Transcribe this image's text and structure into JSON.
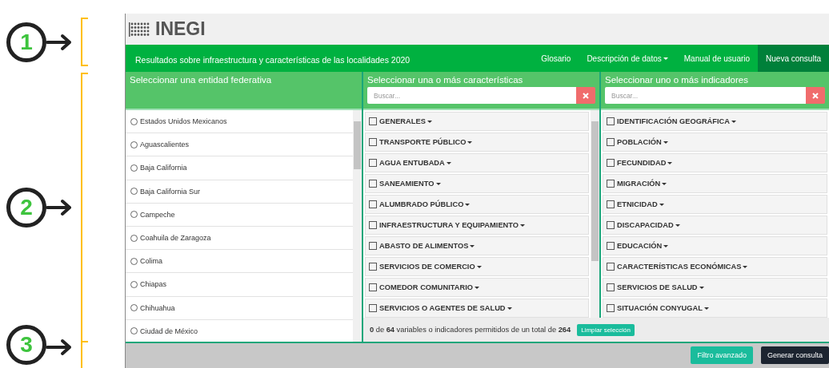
{
  "annotations": [
    {
      "number": "1"
    },
    {
      "number": "2"
    },
    {
      "number": "3"
    }
  ],
  "header": {
    "logo": "INEGI",
    "title": "Resultados sobre infraestructura y características de las localidades 2020",
    "nav": [
      {
        "label": "Glosario",
        "has_menu": false,
        "selected": false
      },
      {
        "label": "Descripción de datos",
        "has_menu": true,
        "selected": false
      },
      {
        "label": "Manual de usuario",
        "has_menu": false,
        "selected": false
      },
      {
        "label": "Nueva consulta",
        "has_menu": false,
        "selected": true
      }
    ]
  },
  "entities": {
    "title": "Seleccionar una entidad federativa",
    "items": [
      {
        "label": "Estados Unidos Mexicanos",
        "selected": false
      },
      {
        "label": "Aguascalientes",
        "selected": false
      },
      {
        "label": "Baja California",
        "selected": false
      },
      {
        "label": "Baja California Sur",
        "selected": false
      },
      {
        "label": "Campeche",
        "selected": false
      },
      {
        "label": "Coahuila de Zaragoza",
        "selected": false
      },
      {
        "label": "Colima",
        "selected": false
      },
      {
        "label": "Chiapas",
        "selected": false
      },
      {
        "label": "Chihuahua",
        "selected": false
      },
      {
        "label": "Ciudad de México",
        "selected": false
      }
    ]
  },
  "characteristics": {
    "title": "Seleccionar una o más características",
    "search": {
      "placeholder": "Buscar..."
    },
    "items": [
      {
        "label": "GENERALES",
        "checked": false
      },
      {
        "label": "TRANSPORTE PÚBLICO",
        "checked": false
      },
      {
        "label": "AGUA ENTUBADA",
        "checked": false
      },
      {
        "label": "SANEAMIENTO",
        "checked": false
      },
      {
        "label": "ALUMBRADO PÚBLICO",
        "checked": false
      },
      {
        "label": "INFRAESTRUCTURA Y EQUIPAMIENTO",
        "checked": false
      },
      {
        "label": "ABASTO DE ALIMENTOS",
        "checked": false
      },
      {
        "label": "SERVICIOS DE COMERCIO",
        "checked": false
      },
      {
        "label": "COMEDOR COMUNITARIO",
        "checked": false
      },
      {
        "label": "SERVICIOS O AGENTES DE SALUD",
        "checked": false
      }
    ]
  },
  "indicators": {
    "title": "Seleccionar uno o más indicadores",
    "search": {
      "placeholder": "Buscar..."
    },
    "items": [
      {
        "label": "IDENTIFICACIÓN GEOGRÁFICA",
        "checked": false
      },
      {
        "label": "POBLACIÓN",
        "checked": false
      },
      {
        "label": "FECUNDIDAD",
        "checked": false
      },
      {
        "label": "MIGRACIÓN",
        "checked": false
      },
      {
        "label": "ETNICIDAD",
        "checked": false
      },
      {
        "label": "DISCAPACIDAD",
        "checked": false
      },
      {
        "label": "EDUCACIÓN",
        "checked": false
      },
      {
        "label": "CARACTERÍSTICAS ECONÓMICAS",
        "checked": false
      },
      {
        "label": "SERVICIOS DE SALUD",
        "checked": false
      },
      {
        "label": "SITUACIÓN CONYUGAL",
        "checked": false
      }
    ]
  },
  "counter": {
    "text": "**0** de **64** variables o indicadores permitidos de un total de **264**",
    "clear_button": "Limpiar selección"
  },
  "footer": {
    "buttons": [
      {
        "label": "Filtro avanzado",
        "kind": "secondary"
      },
      {
        "label": "Generar consulta",
        "kind": "primary"
      }
    ]
  }
}
